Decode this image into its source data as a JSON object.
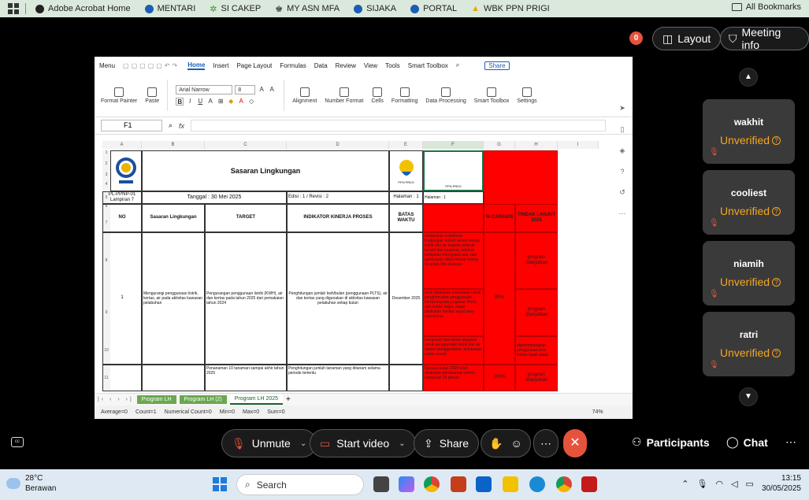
{
  "bookmarks": {
    "items": [
      "Adobe Acrobat Home",
      "MENTARI",
      "SI CAKEP",
      "MY ASN MFA",
      "SIJAKA",
      "PORTAL",
      "WBK PPN PRIGI"
    ],
    "all_label": "All Bookmarks"
  },
  "meeting_top": {
    "notification_count": "0",
    "layout_label": "Layout",
    "meeting_info_label": "Meeting info"
  },
  "participants": [
    {
      "name": "wakhit",
      "status": "Unverified"
    },
    {
      "name": "cooliest",
      "status": "Unverified"
    },
    {
      "name": "niamih",
      "status": "Unverified"
    },
    {
      "name": "ratri",
      "status": "Unverified"
    }
  ],
  "excel": {
    "menu": [
      "Menu",
      "Home",
      "Insert",
      "Page Layout",
      "Formulas",
      "Data",
      "Review",
      "View",
      "Tools",
      "Smart Toolbox"
    ],
    "share_label": "Share",
    "font_name": "Arial Narrow",
    "font_size": "8",
    "ribbon": [
      "Format Painter",
      "Paste",
      "Alignment",
      "Number Format",
      "Cells",
      "Formatting",
      "Data Processing",
      "Smart Toolbox",
      "Settings"
    ],
    "name_box": "F1",
    "fx": "fx",
    "columns": [
      "A",
      "B",
      "C",
      "D",
      "E",
      "F",
      "G",
      "H",
      "I"
    ],
    "rows": [
      "1",
      "2",
      "3",
      "4",
      "5",
      "6",
      "7",
      "8",
      "9",
      "10",
      "11"
    ],
    "title": "Sasaran Lingkungan",
    "doc_code": "PL-PPNP-01 Lampiran 7",
    "tanggal": "Tanggal : 30 Mei 2025",
    "edisi": "Edisi : 1 / Revisi : 2",
    "halaman_e": "Halaman : 1",
    "halaman_f": "Halaman : 1",
    "logo_caption_e": "PPN PRIGI",
    "logo_caption_f": "PPN PRIGI",
    "headers": {
      "no": "NO",
      "sasaran": "Sasaran Lingkungan",
      "target": "TARGET",
      "indikator": "INDIKATOR KINERJA PROSES",
      "batas": "BATAS WAKTU",
      "capaian": "% CAPAIAN",
      "tindak": "TINDAK LANJUT 2025"
    },
    "row1": {
      "no": "1",
      "sasaran": "Mengurangi penggunaan listrik, kertas, air pada aktivitas kawasan pelabuhan",
      "target": "Pengurangan penggunaan listrik (KWH), air dan kertas pada tahun 2025 dari pemakaian tahun 2024",
      "indikator": "Penghitungan jumlah kwh/bulan (penggunaan PLTS), air dan kertas yang digunakan di aktivitas kawasan pelabuhan setiap bulan",
      "batas": "Desember 2025",
      "f8": "melakukan sosialisasi lingkungan terkait hemat energi listrik dan air kepada seluruh tenant dan pegawai, adanya kebijakan mengganti alat, dan penerapan stiker hemat energi di setiap titik strategis",
      "f9": "telah dilakukan sosialisasi untuk penghematan penggunaan kertas kepada pegawai. Perlu ada tindak lanjut, dapat dilakukan melalui rapat atau sejenisnya",
      "f10": "menyurati tata kelola pegawai untuk penggunaan listrik dan air dalam menggerakkan kebiasaan sadar energi",
      "g": "80%",
      "h8": "program dilanjutkan",
      "h9": "program dilanjutkan",
      "h10": "dipertimbangkan penggunaan box kertas layak pakai"
    },
    "row11": {
      "target": "Penanaman 10 tanaman sampai akhir tahun 2025",
      "indikator": "Penghitungan jumlah tanaman yang ditanam selama periode tertentu",
      "f": "Sampai bulan 2025 telah dilakukan penanaman pohon sebanyak 20 pohon",
      "g": "100%",
      "h": "program dilanjutkan"
    },
    "sheet_tabs": [
      "Program LH",
      "Program LH (2)",
      "Program LH 2025"
    ],
    "status": {
      "average": "Average=0",
      "count": "Count=1",
      "numerical": "Numerical Count=0",
      "min": "Min=0",
      "max": "Max=0",
      "sum": "Sum=0",
      "zoom": "74%"
    }
  },
  "controls": {
    "unmute": "Unmute",
    "start_video": "Start video",
    "share": "Share",
    "participants": "Participants",
    "chat": "Chat"
  },
  "taskbar": {
    "temp": "28°C",
    "weather": "Berawan",
    "search": "Search",
    "time": "13:15",
    "date": "30/05/2025"
  }
}
